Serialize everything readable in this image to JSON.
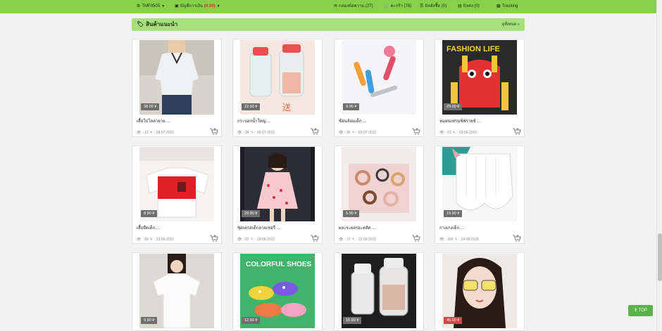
{
  "topbar": {
    "user": "TMF0505",
    "account_label": "บัญชีการเงิน",
    "account_balance": "(0.00)",
    "messages": "กล่องข้อความ (27)",
    "cart": "ตะกร้า (78)",
    "orders": "บิลสั่งซื้อ (0)",
    "shipments": "บิลส่ง (0)",
    "tracking": "Tracking"
  },
  "section": {
    "title": "สินค้าแนะนำ",
    "more": "ดูทั้งหมด »"
  },
  "products": [
    {
      "price": "38.00 ¥",
      "title": "เสื้อโปโลลายาย ...",
      "views": ": 13",
      "date": ": 08-07-2021",
      "price_color": "gray"
    },
    {
      "price": "22.90 ¥",
      "title": "กระบอกน้ำใหญ่ ...",
      "views": ": 34",
      "date": ": 06-07-2021",
      "price_color": "gray"
    },
    {
      "price": "9.90 ¥",
      "title": "ช้อนส้อมเด็ก ...",
      "views": ": 45",
      "date": ": 02-07-2021",
      "price_color": "gray"
    },
    {
      "price": "29.00 ¥",
      "title": "หมอนเฟรนช์ฟรายซ์ ...",
      "views": ": 63",
      "date": ": 29-06-2021",
      "price_color": "gray"
    },
    {
      "price": "8.90 ¥",
      "title": "เสื้อยืดเด็ก ...",
      "views": ": 89",
      "date": ": 23-06-2021",
      "price_color": "gray"
    },
    {
      "price": "29.90 ¥",
      "title": "ชุดเดรสเด็กลายเชอรี่ ...",
      "views": ": 82",
      "date": ": 18-06-2021",
      "price_color": "gray"
    },
    {
      "price": "5.90 ¥",
      "title": "ผละระผลรอะคลิด ...",
      "views": ": 37",
      "date": ": 15-06-2021",
      "price_color": "gray"
    },
    {
      "price": "19.90 ¥",
      "title": "กางเกงเด็ก ...",
      "views": ": 106",
      "date": ": 14-06-2021",
      "price_color": "gray"
    },
    {
      "price": "9.90 ¥",
      "title": "",
      "views": "",
      "date": "",
      "price_color": "gray"
    },
    {
      "price": "12.90 ¥",
      "title": "",
      "views": "",
      "date": "",
      "price_color": "gray",
      "image_text": "COLORFUL SHOES"
    },
    {
      "price": "16.90 ¥",
      "title": "",
      "views": "",
      "date": "",
      "price_color": "gray"
    },
    {
      "price": "45.00 ¥",
      "title": "",
      "views": "",
      "date": "",
      "price_color": "red"
    }
  ],
  "image_texts": {
    "fashion_life": "FASHION LIFE",
    "colorful_shoes": "COLORFUL SHOES"
  },
  "top_button": "TOP",
  "colors": {
    "accent_green": "#86d04a",
    "header_green": "#a6e07c",
    "price_gray": "#6f6f6f",
    "price_red": "#e0404a"
  }
}
